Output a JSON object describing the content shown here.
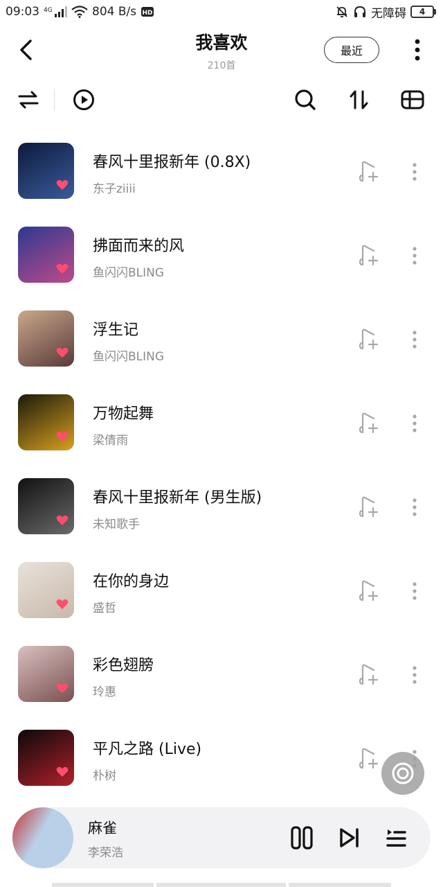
{
  "status_bar": {
    "time": "09:03",
    "net_type": "4G",
    "speed": "804 B/s",
    "hd": "HD",
    "accessibility": "无障碍",
    "battery": "4"
  },
  "header": {
    "title": "我喜欢",
    "count": "210首",
    "recent_label": "最近"
  },
  "songs": [
    {
      "title": "春风十里报新年 (0.8X)",
      "artist": "东子ziiii",
      "cover_colors": [
        "#0d1b3d",
        "#3b5a9a"
      ]
    },
    {
      "title": "拂面而来的风",
      "artist": "鱼闪闪BLING",
      "cover_colors": [
        "#2a3a8f",
        "#c04a8a"
      ]
    },
    {
      "title": "浮生记",
      "artist": "鱼闪闪BLING",
      "cover_colors": [
        "#c9a88a",
        "#5a3a3a"
      ]
    },
    {
      "title": "万物起舞",
      "artist": "梁倩雨",
      "cover_colors": [
        "#1a1a0a",
        "#d8a020"
      ]
    },
    {
      "title": "春风十里报新年 (男生版)",
      "artist": "未知歌手",
      "cover_colors": [
        "#111111",
        "#6a6a6a"
      ]
    },
    {
      "title": "在你的身边",
      "artist": "盛哲",
      "cover_colors": [
        "#e8e2dc",
        "#c8b8a8"
      ]
    },
    {
      "title": "彩色翅膀",
      "artist": "玲惠",
      "cover_colors": [
        "#d8c0c0",
        "#7a5050"
      ]
    },
    {
      "title": "平凡之路 (Live)",
      "artist": "朴树",
      "cover_colors": [
        "#0a0a0a",
        "#b0202a"
      ]
    }
  ],
  "now_playing": {
    "title": "麻雀",
    "artist": "李荣浩",
    "cover_colors": [
      "#b8d0e8",
      "#c83030"
    ]
  },
  "colors": {
    "heart": "#ff4d6d",
    "icon": "#111111",
    "muted_icon": "#a8a8a8"
  }
}
